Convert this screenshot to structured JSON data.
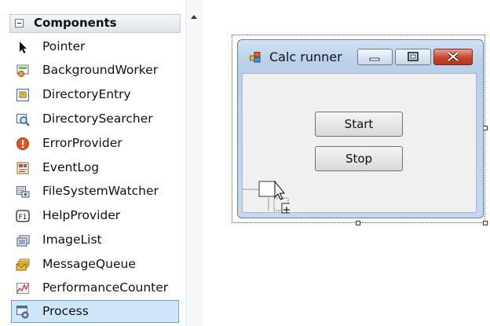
{
  "toolbox": {
    "header": "Components",
    "items": [
      {
        "label": "Pointer",
        "icon": "pointer-icon"
      },
      {
        "label": "BackgroundWorker",
        "icon": "background-worker-icon"
      },
      {
        "label": "DirectoryEntry",
        "icon": "directory-entry-icon"
      },
      {
        "label": "DirectorySearcher",
        "icon": "directory-searcher-icon"
      },
      {
        "label": "ErrorProvider",
        "icon": "error-provider-icon"
      },
      {
        "label": "EventLog",
        "icon": "event-log-icon"
      },
      {
        "label": "FileSystemWatcher",
        "icon": "file-system-watcher-icon"
      },
      {
        "label": "HelpProvider",
        "icon": "help-provider-icon"
      },
      {
        "label": "ImageList",
        "icon": "image-list-icon"
      },
      {
        "label": "MessageQueue",
        "icon": "message-queue-icon"
      },
      {
        "label": "PerformanceCounter",
        "icon": "performance-counter-icon"
      },
      {
        "label": "Process",
        "icon": "process-icon",
        "selected": true
      }
    ]
  },
  "form": {
    "title": "Calc runner",
    "buttons": {
      "start": "Start",
      "stop": "Stop"
    }
  },
  "colors": {
    "selection_bg": "#cfe5fa",
    "selection_border": "#6da1d3",
    "close_red": "#c8452e",
    "title_bar": "#b9d0ea"
  }
}
